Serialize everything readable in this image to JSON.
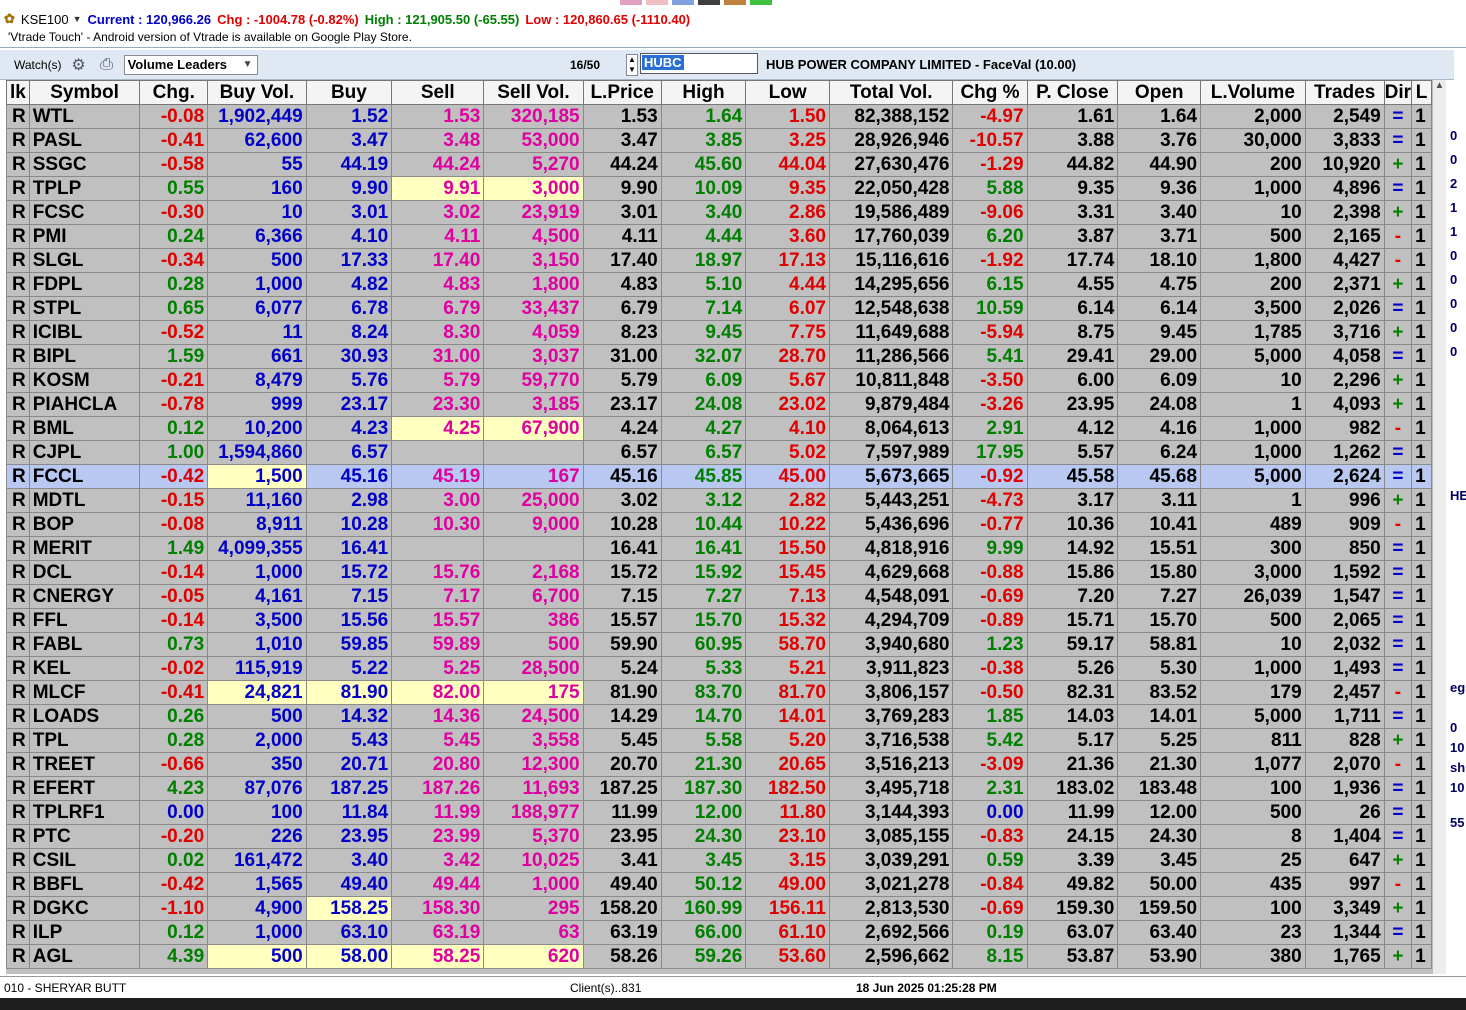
{
  "ticker": {
    "index": "KSE100",
    "current": "Current : 120,966.26",
    "chg": "Chg : -1004.78 (-0.82%)",
    "high": "High : 121,905.50  (-65.55)",
    "low": "Low : 120,860.65  (-1110.40)"
  },
  "news": "'Vtrade Touch' - Android version of Vtrade is available on Google Play Store.",
  "toolbar": {
    "watch_label": "Watch(s)",
    "selected_view": "Volume Leaders",
    "count": "16/50",
    "search_value": "HUBC",
    "company": "HUB POWER COMPANY LIMITED - FaceVal (10.00)"
  },
  "columns": [
    "lk",
    "Symbol",
    "Chg.",
    "Buy Vol.",
    "Buy",
    "Sell",
    "Sell Vol.",
    "L.Price",
    "High",
    "Low",
    "Total Vol.",
    "Chg %",
    "P. Close",
    "Open",
    "L.Volume",
    "Trades",
    "Dir",
    "L"
  ],
  "rows": [
    [
      "R",
      "WTL",
      "-0.08",
      "1,902,449",
      "1.52",
      "1.53",
      "320,185",
      "1.53",
      "1.64",
      "1.50",
      "82,388,152",
      "-4.97",
      "1.61",
      "1.64",
      "2,000",
      "2,549",
      "=",
      "1"
    ],
    [
      "R",
      "PASL",
      "-0.41",
      "62,600",
      "3.47",
      "3.48",
      "53,000",
      "3.47",
      "3.85",
      "3.25",
      "28,926,946",
      "-10.57",
      "3.88",
      "3.76",
      "30,000",
      "3,833",
      "=",
      "1"
    ],
    [
      "R",
      "SSGC",
      "-0.58",
      "55",
      "44.19",
      "44.24",
      "5,270",
      "44.24",
      "45.60",
      "44.04",
      "27,630,476",
      "-1.29",
      "44.82",
      "44.90",
      "200",
      "10,920",
      "+",
      "1"
    ],
    [
      "R",
      "TPLP",
      "0.55",
      "160",
      "9.90",
      "9.91",
      "3,000",
      "9.90",
      "10.09",
      "9.35",
      "22,050,428",
      "5.88",
      "9.35",
      "9.36",
      "1,000",
      "4,896",
      "=",
      "1"
    ],
    [
      "R",
      "FCSC",
      "-0.30",
      "10",
      "3.01",
      "3.02",
      "23,919",
      "3.01",
      "3.40",
      "2.86",
      "19,586,489",
      "-9.06",
      "3.31",
      "3.40",
      "10",
      "2,398",
      "+",
      "1"
    ],
    [
      "R",
      "PMI",
      "0.24",
      "6,366",
      "4.10",
      "4.11",
      "4,500",
      "4.11",
      "4.44",
      "3.60",
      "17,760,039",
      "6.20",
      "3.87",
      "3.71",
      "500",
      "2,165",
      "-",
      "1"
    ],
    [
      "R",
      "SLGL",
      "-0.34",
      "500",
      "17.33",
      "17.40",
      "3,150",
      "17.40",
      "18.97",
      "17.13",
      "15,116,616",
      "-1.92",
      "17.74",
      "18.10",
      "1,800",
      "4,427",
      "-",
      "1"
    ],
    [
      "R",
      "FDPL",
      "0.28",
      "1,000",
      "4.82",
      "4.83",
      "1,800",
      "4.83",
      "5.10",
      "4.44",
      "14,295,656",
      "6.15",
      "4.55",
      "4.75",
      "200",
      "2,371",
      "+",
      "1"
    ],
    [
      "R",
      "STPL",
      "0.65",
      "6,077",
      "6.78",
      "6.79",
      "33,437",
      "6.79",
      "7.14",
      "6.07",
      "12,548,638",
      "10.59",
      "6.14",
      "6.14",
      "3,500",
      "2,026",
      "=",
      "1"
    ],
    [
      "R",
      "ICIBL",
      "-0.52",
      "11",
      "8.24",
      "8.30",
      "4,059",
      "8.23",
      "9.45",
      "7.75",
      "11,649,688",
      "-5.94",
      "8.75",
      "9.45",
      "1,785",
      "3,716",
      "+",
      "1"
    ],
    [
      "R",
      "BIPL",
      "1.59",
      "661",
      "30.93",
      "31.00",
      "3,037",
      "31.00",
      "32.07",
      "28.70",
      "11,286,566",
      "5.41",
      "29.41",
      "29.00",
      "5,000",
      "4,058",
      "=",
      "1"
    ],
    [
      "R",
      "KOSM",
      "-0.21",
      "8,479",
      "5.76",
      "5.79",
      "59,770",
      "5.79",
      "6.09",
      "5.67",
      "10,811,848",
      "-3.50",
      "6.00",
      "6.09",
      "10",
      "2,296",
      "+",
      "1"
    ],
    [
      "R",
      "PIAHCLA",
      "-0.78",
      "999",
      "23.17",
      "23.30",
      "3,185",
      "23.17",
      "24.08",
      "23.02",
      "9,879,484",
      "-3.26",
      "23.95",
      "24.08",
      "1",
      "4,093",
      "+",
      "1"
    ],
    [
      "R",
      "BML",
      "0.12",
      "10,200",
      "4.23",
      "4.25",
      "67,900",
      "4.24",
      "4.27",
      "4.10",
      "8,064,613",
      "2.91",
      "4.12",
      "4.16",
      "1,000",
      "982",
      "-",
      "1"
    ],
    [
      "R",
      "CJPL",
      "1.00",
      "1,594,860",
      "6.57",
      "",
      "",
      "6.57",
      "6.57",
      "5.02",
      "7,597,989",
      "17.95",
      "5.57",
      "6.24",
      "1,000",
      "1,262",
      "=",
      "1"
    ],
    [
      "R",
      "FCCL",
      "-0.42",
      "1,500",
      "45.16",
      "45.19",
      "167",
      "45.16",
      "45.85",
      "45.00",
      "5,673,665",
      "-0.92",
      "45.58",
      "45.68",
      "5,000",
      "2,624",
      "=",
      "1"
    ],
    [
      "R",
      "MDTL",
      "-0.15",
      "11,160",
      "2.98",
      "3.00",
      "25,000",
      "3.02",
      "3.12",
      "2.82",
      "5,443,251",
      "-4.73",
      "3.17",
      "3.11",
      "1",
      "996",
      "+",
      "1"
    ],
    [
      "R",
      "BOP",
      "-0.08",
      "8,911",
      "10.28",
      "10.30",
      "9,000",
      "10.28",
      "10.44",
      "10.22",
      "5,436,696",
      "-0.77",
      "10.36",
      "10.41",
      "489",
      "909",
      "-",
      "1"
    ],
    [
      "R",
      "MERIT",
      "1.49",
      "4,099,355",
      "16.41",
      "",
      "",
      "16.41",
      "16.41",
      "15.50",
      "4,818,916",
      "9.99",
      "14.92",
      "15.51",
      "300",
      "850",
      "=",
      "1"
    ],
    [
      "R",
      "DCL",
      "-0.14",
      "1,000",
      "15.72",
      "15.76",
      "2,168",
      "15.72",
      "15.92",
      "15.45",
      "4,629,668",
      "-0.88",
      "15.86",
      "15.80",
      "3,000",
      "1,592",
      "=",
      "1"
    ],
    [
      "R",
      "CNERGY",
      "-0.05",
      "4,161",
      "7.15",
      "7.17",
      "6,700",
      "7.15",
      "7.27",
      "7.13",
      "4,548,091",
      "-0.69",
      "7.20",
      "7.27",
      "26,039",
      "1,547",
      "=",
      "1"
    ],
    [
      "R",
      "FFL",
      "-0.14",
      "3,500",
      "15.56",
      "15.57",
      "386",
      "15.57",
      "15.70",
      "15.32",
      "4,294,709",
      "-0.89",
      "15.71",
      "15.70",
      "500",
      "2,065",
      "=",
      "1"
    ],
    [
      "R",
      "FABL",
      "0.73",
      "1,010",
      "59.85",
      "59.89",
      "500",
      "59.90",
      "60.95",
      "58.70",
      "3,940,680",
      "1.23",
      "59.17",
      "58.81",
      "10",
      "2,032",
      "=",
      "1"
    ],
    [
      "R",
      "KEL",
      "-0.02",
      "115,919",
      "5.22",
      "5.25",
      "28,500",
      "5.24",
      "5.33",
      "5.21",
      "3,911,823",
      "-0.38",
      "5.26",
      "5.30",
      "1,000",
      "1,493",
      "=",
      "1"
    ],
    [
      "R",
      "MLCF",
      "-0.41",
      "24,821",
      "81.90",
      "82.00",
      "175",
      "81.90",
      "83.70",
      "81.70",
      "3,806,157",
      "-0.50",
      "82.31",
      "83.52",
      "179",
      "2,457",
      "-",
      "1"
    ],
    [
      "R",
      "LOADS",
      "0.26",
      "500",
      "14.32",
      "14.36",
      "24,500",
      "14.29",
      "14.70",
      "14.01",
      "3,769,283",
      "1.85",
      "14.03",
      "14.01",
      "5,000",
      "1,711",
      "=",
      "1"
    ],
    [
      "R",
      "TPL",
      "0.28",
      "2,000",
      "5.43",
      "5.45",
      "3,558",
      "5.45",
      "5.58",
      "5.20",
      "3,716,538",
      "5.42",
      "5.17",
      "5.25",
      "811",
      "828",
      "+",
      "1"
    ],
    [
      "R",
      "TREET",
      "-0.66",
      "350",
      "20.71",
      "20.80",
      "12,300",
      "20.70",
      "21.30",
      "20.65",
      "3,516,213",
      "-3.09",
      "21.36",
      "21.30",
      "1,077",
      "2,070",
      "-",
      "1"
    ],
    [
      "R",
      "EFERT",
      "4.23",
      "87,076",
      "187.25",
      "187.26",
      "11,693",
      "187.25",
      "187.30",
      "182.50",
      "3,495,718",
      "2.31",
      "183.02",
      "183.48",
      "100",
      "1,936",
      "=",
      "1"
    ],
    [
      "R",
      "TPLRF1",
      "0.00",
      "100",
      "11.84",
      "11.99",
      "188,977",
      "11.99",
      "12.00",
      "11.80",
      "3,144,393",
      "0.00",
      "11.99",
      "12.00",
      "500",
      "26",
      "=",
      "1"
    ],
    [
      "R",
      "PTC",
      "-0.20",
      "226",
      "23.95",
      "23.99",
      "5,370",
      "23.95",
      "24.30",
      "23.10",
      "3,085,155",
      "-0.83",
      "24.15",
      "24.30",
      "8",
      "1,404",
      "=",
      "1"
    ],
    [
      "R",
      "CSIL",
      "0.02",
      "161,472",
      "3.40",
      "3.42",
      "10,025",
      "3.41",
      "3.45",
      "3.15",
      "3,039,291",
      "0.59",
      "3.39",
      "3.45",
      "25",
      "647",
      "+",
      "1"
    ],
    [
      "R",
      "BBFL",
      "-0.42",
      "1,565",
      "49.40",
      "49.44",
      "1,000",
      "49.40",
      "50.12",
      "49.00",
      "3,021,278",
      "-0.84",
      "49.82",
      "50.00",
      "435",
      "997",
      "-",
      "1"
    ],
    [
      "R",
      "DGKC",
      "-1.10",
      "4,900",
      "158.25",
      "158.30",
      "295",
      "158.20",
      "160.99",
      "156.11",
      "2,813,530",
      "-0.69",
      "159.30",
      "159.50",
      "100",
      "3,349",
      "+",
      "1"
    ],
    [
      "R",
      "ILP",
      "0.12",
      "1,000",
      "63.10",
      "63.19",
      "63",
      "63.19",
      "66.00",
      "61.10",
      "2,692,566",
      "0.19",
      "63.07",
      "63.40",
      "23",
      "1,344",
      "=",
      "1"
    ],
    [
      "R",
      "AGL",
      "4.39",
      "500",
      "58.00",
      "58.25",
      "620",
      "58.26",
      "59.26",
      "53.60",
      "2,596,662",
      "8.15",
      "53.87",
      "53.90",
      "380",
      "1,765",
      "+",
      "1"
    ]
  ],
  "highlights": {
    "TPLP": [
      5,
      6
    ],
    "BML": [
      5,
      6
    ],
    "FCCL": [
      3
    ],
    "MLCF": [
      3,
      4,
      5,
      6
    ],
    "DGKC": [
      4
    ],
    "AGL": [
      3,
      4,
      5,
      6
    ]
  },
  "selected_row": "FCCL",
  "right_edge_glyphs": [
    "0",
    "0",
    "2",
    "1",
    "1",
    "0",
    "0",
    "0",
    "0",
    "0",
    "HE",
    "eg",
    "0",
    "10",
    "sh",
    "10",
    "55"
  ],
  "status": {
    "user": "010 - SHERYAR BUTT",
    "clients": "Client(s)..831",
    "datetime": "18 Jun 2025 01:25:28 PM"
  },
  "colors": {
    "negative": "#e00000",
    "positive": "#008000",
    "buy": "#0000c8",
    "sell": "#e000a0",
    "highlight": "#ffffc0",
    "selected_row": "#b8c8f0",
    "toolbar_bg": "#dfe8f3"
  }
}
